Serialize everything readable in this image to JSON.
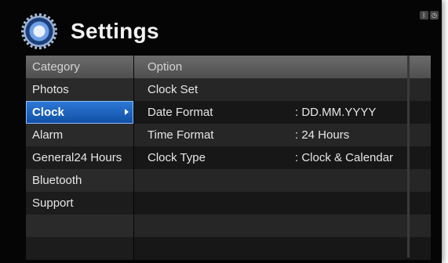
{
  "header": {
    "title": "Settings"
  },
  "status_icons": [
    {
      "name": "bluetooth-icon",
      "glyph": "ᛒ"
    },
    {
      "name": "clock-icon",
      "glyph": "◷"
    }
  ],
  "columns": {
    "category": "Category",
    "option": "Option"
  },
  "categories": [
    "Photos",
    "Clock",
    "Alarm",
    "General24 Hours",
    "Bluetooth",
    "Support"
  ],
  "selected_category": "Clock",
  "options": [
    {
      "name": "Clock Set",
      "value": ""
    },
    {
      "name": "Date Format",
      "value": ": DD.MM.YYYY"
    },
    {
      "name": "Time Format",
      "value": ": 24 Hours"
    },
    {
      "name": "Clock Type",
      "value": ": Clock & Calendar"
    }
  ],
  "colors": {
    "selection": "#1f63c0",
    "header_row": "#5f5f5f",
    "background": "#050505"
  }
}
